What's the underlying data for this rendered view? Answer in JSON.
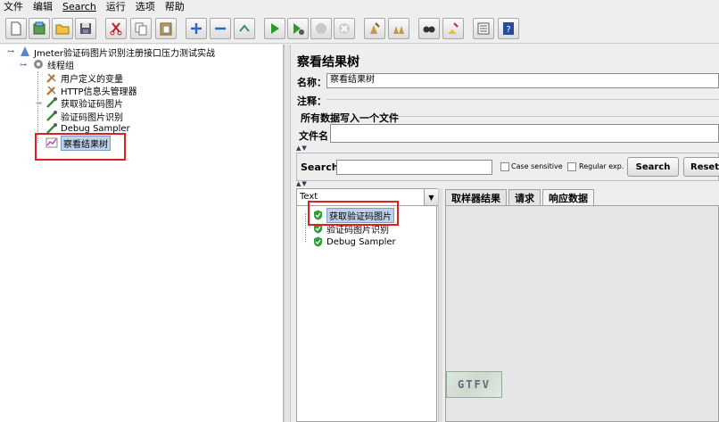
{
  "menu": {
    "items": [
      "文件",
      "编辑",
      "Search",
      "运行",
      "选项",
      "帮助"
    ]
  },
  "toolbar": {
    "buttons": [
      "new-icon",
      "templates-icon",
      "open-icon",
      "save-icon",
      "cut-icon",
      "copy-icon",
      "paste-icon",
      "expand-icon",
      "collapse-icon",
      "toggle-icon",
      "start-icon",
      "start-no-pause-icon",
      "stop-icon",
      "shutdown-icon",
      "clear-icon",
      "clear-all-icon",
      "search-icon",
      "reset-search-icon",
      "function-helper-icon",
      "help-icon"
    ]
  },
  "tree": {
    "root": "Jmeter验证码图片识别注册接口压力测试实战",
    "thread_group": "线程组",
    "children": [
      "用户定义的变量",
      "HTTP信息头管理器",
      "获取验证码图片",
      "验证码图片识别",
      "Debug Sampler",
      "察看结果树"
    ]
  },
  "panel": {
    "title": "察看结果树",
    "name_label": "名称：",
    "name_value": "察看结果树",
    "comment_label": "注释：",
    "write_all_label": "所有数据写入一个文件",
    "filename_label": "文件名"
  },
  "search": {
    "label": "Search:",
    "value": "",
    "case_sensitive": "Case sensitive",
    "regular_exp": "Regular exp.",
    "search_button": "Search",
    "reset_button": "Reset"
  },
  "results": {
    "renderer": "Text",
    "items": [
      "获取验证码图片",
      "验证码图片识别",
      "Debug Sampler"
    ]
  },
  "tabs": [
    "取样器结果",
    "请求",
    "响应数据"
  ],
  "captcha_text": "GTFV",
  "colors": {
    "selection": "#bfd2ec",
    "highlight": "#e02020",
    "success": "#2e9e3a"
  }
}
